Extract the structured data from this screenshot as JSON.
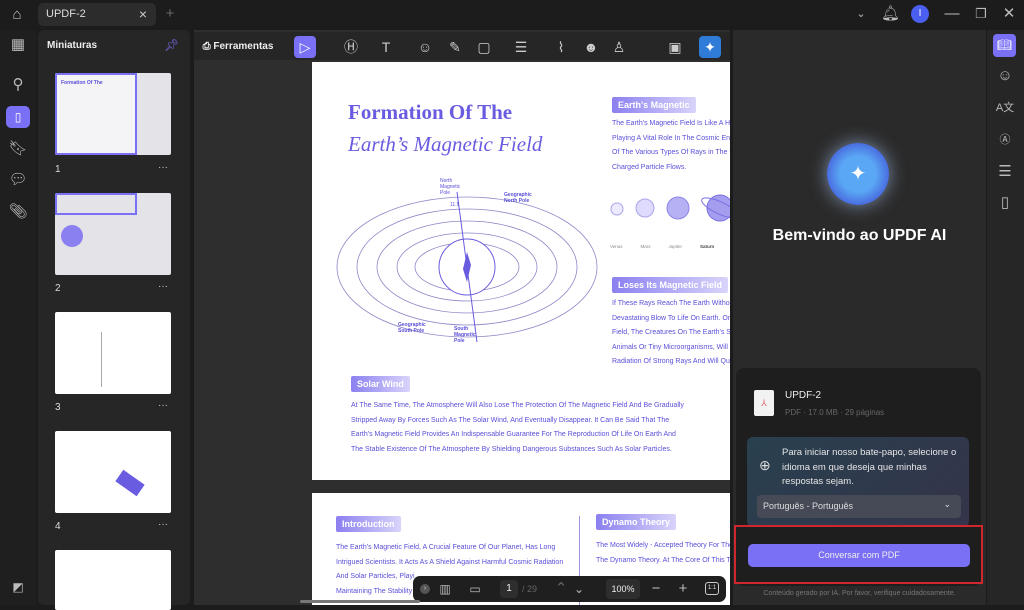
{
  "tabbar": {
    "tab_title": "UPDF-2",
    "close": "×",
    "new_tab": "+",
    "avatar_letter": "I"
  },
  "thumbnails": {
    "title": "Miniaturas",
    "pages": [
      {
        "label": "1"
      },
      {
        "label": "2"
      },
      {
        "label": "3"
      },
      {
        "label": "4"
      }
    ],
    "more": "···"
  },
  "toolbar": {
    "tools_label": "Ferramentas"
  },
  "page1": {
    "title1": "Formation Of The",
    "title2": "Earth’s Magnetic Field",
    "earth_header": "Earth's Magnetic",
    "earth_lines": [
      "The Earth's Magnetic Field Is Like A Hu",
      "Playing A Vital Role In The Cosmic Env",
      "Of The Various Types Of Rays in The U",
      "Charged Particle Flows."
    ],
    "planets": [
      "Venus",
      "Mars",
      "Jupiter",
      "Saturn"
    ],
    "diagram_labels": {
      "north_mag": "North Magnetic Pole",
      "geo_north": "Geographic North Pole",
      "geo_south": "Geographic South Pole",
      "south_mag": "South Magnetic Pole",
      "angle": "11.5"
    },
    "loses_header": "Loses Its Magnetic Field",
    "loses_lines": [
      "If These Rays Reach The Earth Without",
      "Devastating Blow To Life On Earth. Onc",
      "Field, The Creatures On The Earth's Su",
      "Animals Or Tiny Microorganisms, Will F",
      "Radiation Of Strong Rays And Will Quic"
    ],
    "solar_header": "Solar Wind",
    "solar_lines": [
      "At The Same Time, The Atmosphere Will Also Lose The Protection Of The Magnetic Field And Be Gradually",
      "Stripped Away By Forces Such As The Solar Wind, And Eventually Disappear. It Can Be Said That The",
      "Earth's Magnetic Field Provides An Indispensable Guarantee For The Reproduction Of Life On Earth And",
      "The Stable Existence Of The Atmosphere By Shielding Dangerous Substances Such As Solar Particles."
    ]
  },
  "page2": {
    "intro_header": "Introduction",
    "intro_lines": [
      "The Earth's Magnetic Field, A Crucial Feature Of Our Planet, Has Long",
      "Intrigued Scientists. It Acts As A Shield Against Harmful Cosmic Radiation",
      "And Solar Particles, Playi",
      "Maintaining The Stability O"
    ],
    "dynamo_header": "Dynamo Theory",
    "dynamo_lines": [
      "The Most Widely - Accepted Theory For The",
      "The Dynamo Theory. At The Core Of This Th"
    ]
  },
  "bottombar": {
    "page_current": "1",
    "page_total": "/ 29",
    "zoom": "100%"
  },
  "ai": {
    "welcome": "Bem-vindo ao UPDF AI",
    "file_name": "UPDF-2",
    "file_meta": "PDF · 17.0 MB · 29 páginas",
    "prompt": "Para iniciar nosso bate-papo, selecione o idioma em que deseja que minhas respostas sejam.",
    "language": "Português - Português",
    "chat_button": "Conversar com PDF",
    "disclaimer": "Conteúdo gerado por IA. Por favor, verifique cuidadosamente."
  },
  "colors": {
    "accent": "#7a70f5",
    "highlight": "#d0262e"
  }
}
